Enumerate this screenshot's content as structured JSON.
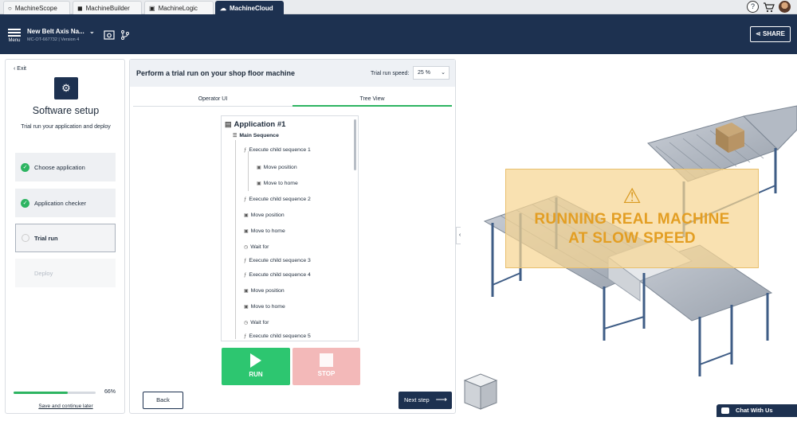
{
  "tabs": [
    {
      "label": "MachineScope",
      "icon": "scope-icon",
      "active": false
    },
    {
      "label": "MachineBuilder",
      "icon": "cube-icon",
      "active": false
    },
    {
      "label": "MachineLogic",
      "icon": "code-icon",
      "active": false
    },
    {
      "label": "MachineCloud",
      "icon": "cloud-icon",
      "active": true
    }
  ],
  "topbar": {
    "help": "?",
    "cart_icon": "cart-icon"
  },
  "header": {
    "menu_label": "Menu",
    "project_name": "New Belt Axis Na...",
    "project_sub": "MC-OT-667732 | Version 4",
    "share_label": "SHARE"
  },
  "left": {
    "exit": "‹ Exit",
    "title": "Software setup",
    "subtitle": "Trial run your application and deploy",
    "steps": [
      {
        "label": "Choose application",
        "state": "done"
      },
      {
        "label": "Application checker",
        "state": "done"
      },
      {
        "label": "Trial run",
        "state": "current"
      },
      {
        "label": "Deploy",
        "state": "disabled"
      }
    ],
    "progress_pct": "66%",
    "progress_value": 0.66,
    "save_link": "Save and continue later"
  },
  "main": {
    "title": "Perform a trial run on your shop floor machine",
    "speed_label": "Trial run speed:",
    "speed_value": "25 %",
    "view_tabs": [
      "Operator UI",
      "Tree View"
    ],
    "active_view": "Tree View",
    "tree": {
      "app": "Application #1",
      "main_seq": "Main Sequence",
      "items": [
        "Execute child sequence 1",
        "Move position",
        "Move to home",
        "Execute child sequence 2",
        "Move position",
        "Move to home",
        "Wait for",
        "Execute child sequence 3",
        "Execute child sequence 4",
        "Move position",
        "Move to home",
        "Wait for",
        "Execute child sequence 5"
      ]
    },
    "run_label": "RUN",
    "stop_label": "STOP",
    "back_label": "Back",
    "next_label": "Next step"
  },
  "viewer": {
    "warning": [
      "RUNNING REAL MACHINE",
      "AT SLOW SPEED"
    ],
    "warning_icon": "warning-triangle-icon",
    "colors": {
      "warning_text": "#e39e23",
      "accent_green": "#2db461",
      "navy": "#1d3150"
    }
  },
  "chat_label": "Chat With Us"
}
